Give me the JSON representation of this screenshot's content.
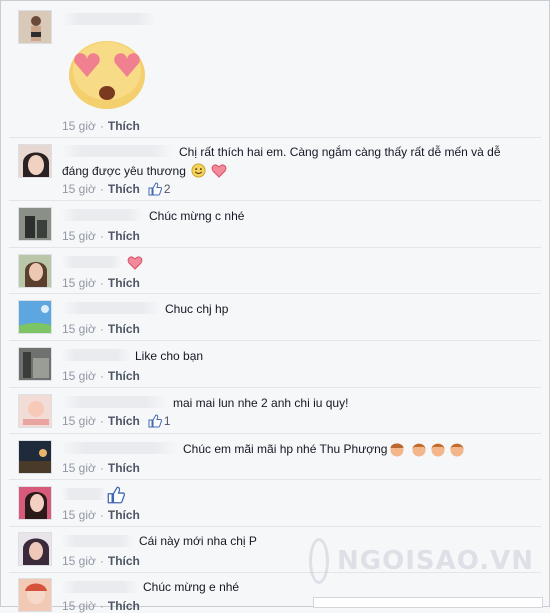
{
  "time": "15 giờ",
  "like_label": "Thích",
  "comments": [
    {
      "text": "",
      "like_count": ""
    },
    {
      "text": "Chị rất thích hai em. Càng ngắm càng thấy rất dễ mến và dễ",
      "text2": "đáng được yêu thương",
      "like_count": "2"
    },
    {
      "text": "Chúc mừng c nhé",
      "like_count": ""
    },
    {
      "text": "",
      "like_count": ""
    },
    {
      "text": "Chuc chj hp",
      "like_count": ""
    },
    {
      "text": "Like cho bạn",
      "like_count": ""
    },
    {
      "text": "mai mai lun nhe 2 anh chi iu quy!",
      "like_count": "1"
    },
    {
      "text": "Chúc em mãi mãi hp nhé Thu Phượng",
      "like_count": ""
    },
    {
      "text": "",
      "like_count": ""
    },
    {
      "text": "Cái này mới nha chị P",
      "like_count": ""
    },
    {
      "text": "Chúc mừng e nhé",
      "like_count": ""
    }
  ],
  "watermark": "NGOISAO.VN",
  "colors": {
    "like_blue": "#4267b2",
    "meta_gray": "#9197a3",
    "heart": "#e8586e"
  }
}
